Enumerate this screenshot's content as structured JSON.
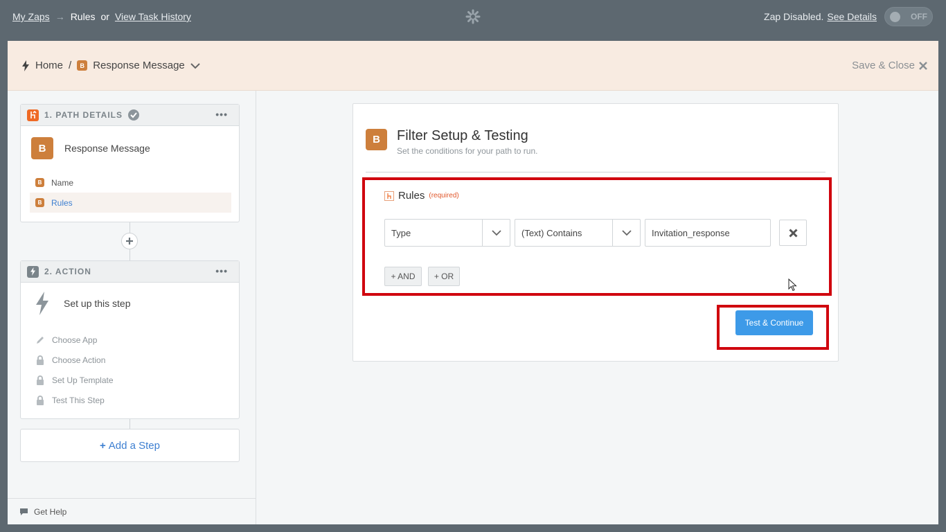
{
  "topbar": {
    "my_zaps": "My Zaps",
    "arrow": "→",
    "rules": "Rules",
    "or": "or",
    "task_history": "View Task History",
    "status_text": "Zap Disabled.",
    "see_details": "See Details",
    "toggle_label": "OFF"
  },
  "header": {
    "home": "Home",
    "sep": "/",
    "badge": "B",
    "path_name": "Response Message",
    "save_close": "Save & Close"
  },
  "sidebar": {
    "path_card": {
      "title": "1. PATH DETAILS",
      "dots": "•••",
      "badge": "B",
      "name": "Response Message",
      "items": [
        {
          "badge": "B",
          "label": "Name"
        },
        {
          "badge": "B",
          "label": "Rules"
        }
      ]
    },
    "action_card": {
      "title": "2. ACTION",
      "dots": "•••",
      "name": "Set up this step",
      "items": [
        {
          "icon": "pencil-icon",
          "label": "Choose App"
        },
        {
          "icon": "lock-icon",
          "label": "Choose Action"
        },
        {
          "icon": "lock-icon",
          "label": "Set Up Template"
        },
        {
          "icon": "lock-icon",
          "label": "Test This Step"
        }
      ]
    },
    "add_step": "Add a Step",
    "get_help": "Get Help"
  },
  "panel": {
    "badge": "B",
    "title": "Filter Setup & Testing",
    "subtitle": "Set the conditions for your path to run.",
    "rules_label": "Rules",
    "required": "(required)",
    "field_select": "Type",
    "condition_select": "(Text) Contains",
    "value_input": "Invitation_response",
    "and_button": "+ AND",
    "or_button": "+ OR",
    "test_button": "Test & Continue"
  },
  "colors": {
    "topbar": "#5d6870",
    "brand_orange": "#cd7f3c",
    "primary_blue": "#3d9ae8",
    "highlight_red": "#d0040e",
    "link_blue": "#3d7fd1"
  }
}
